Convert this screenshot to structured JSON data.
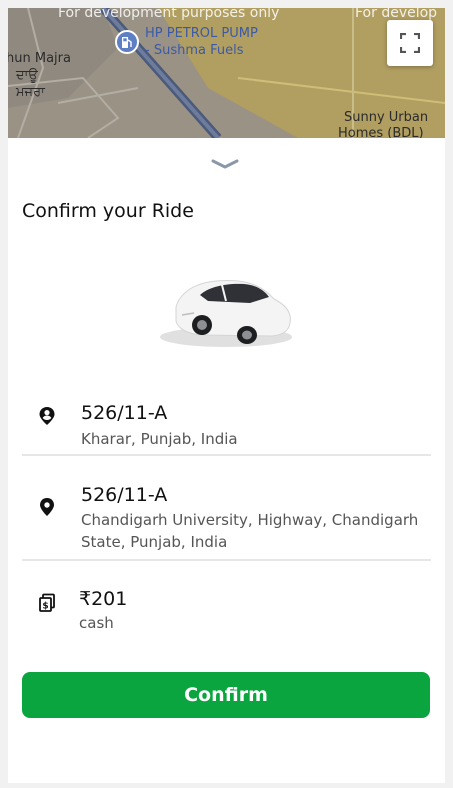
{
  "map": {
    "watermark_left": "For development purposes only",
    "watermark_right": "For develop",
    "label_place_en": "hun Majra",
    "label_place_pa_1": "ਦਾਊ",
    "label_place_pa_2": "ਮਜਰਾ",
    "label_pump_1": "HP PETROL PUMP",
    "label_pump_2": "- Sushma Fuels",
    "label_homes_1": "Sunny Urban",
    "label_homes_2": "Homes (BDL)"
  },
  "title": "Confirm your Ride",
  "pickup": {
    "name": "526/11-A",
    "address": "Kharar, Punjab, India",
    "icon": "person-pin-icon"
  },
  "dropoff": {
    "name": "526/11-A",
    "address": "Chandigarh University, Highway, Chandigarh State, Punjab, India",
    "icon": "location-pin-icon"
  },
  "payment": {
    "amount": "₹201",
    "method": "cash",
    "icon": "cash-icon"
  },
  "confirm_label": "Confirm",
  "colors": {
    "confirm_button": "#0aa53e",
    "map_road_yellow": "#c9b25a"
  }
}
